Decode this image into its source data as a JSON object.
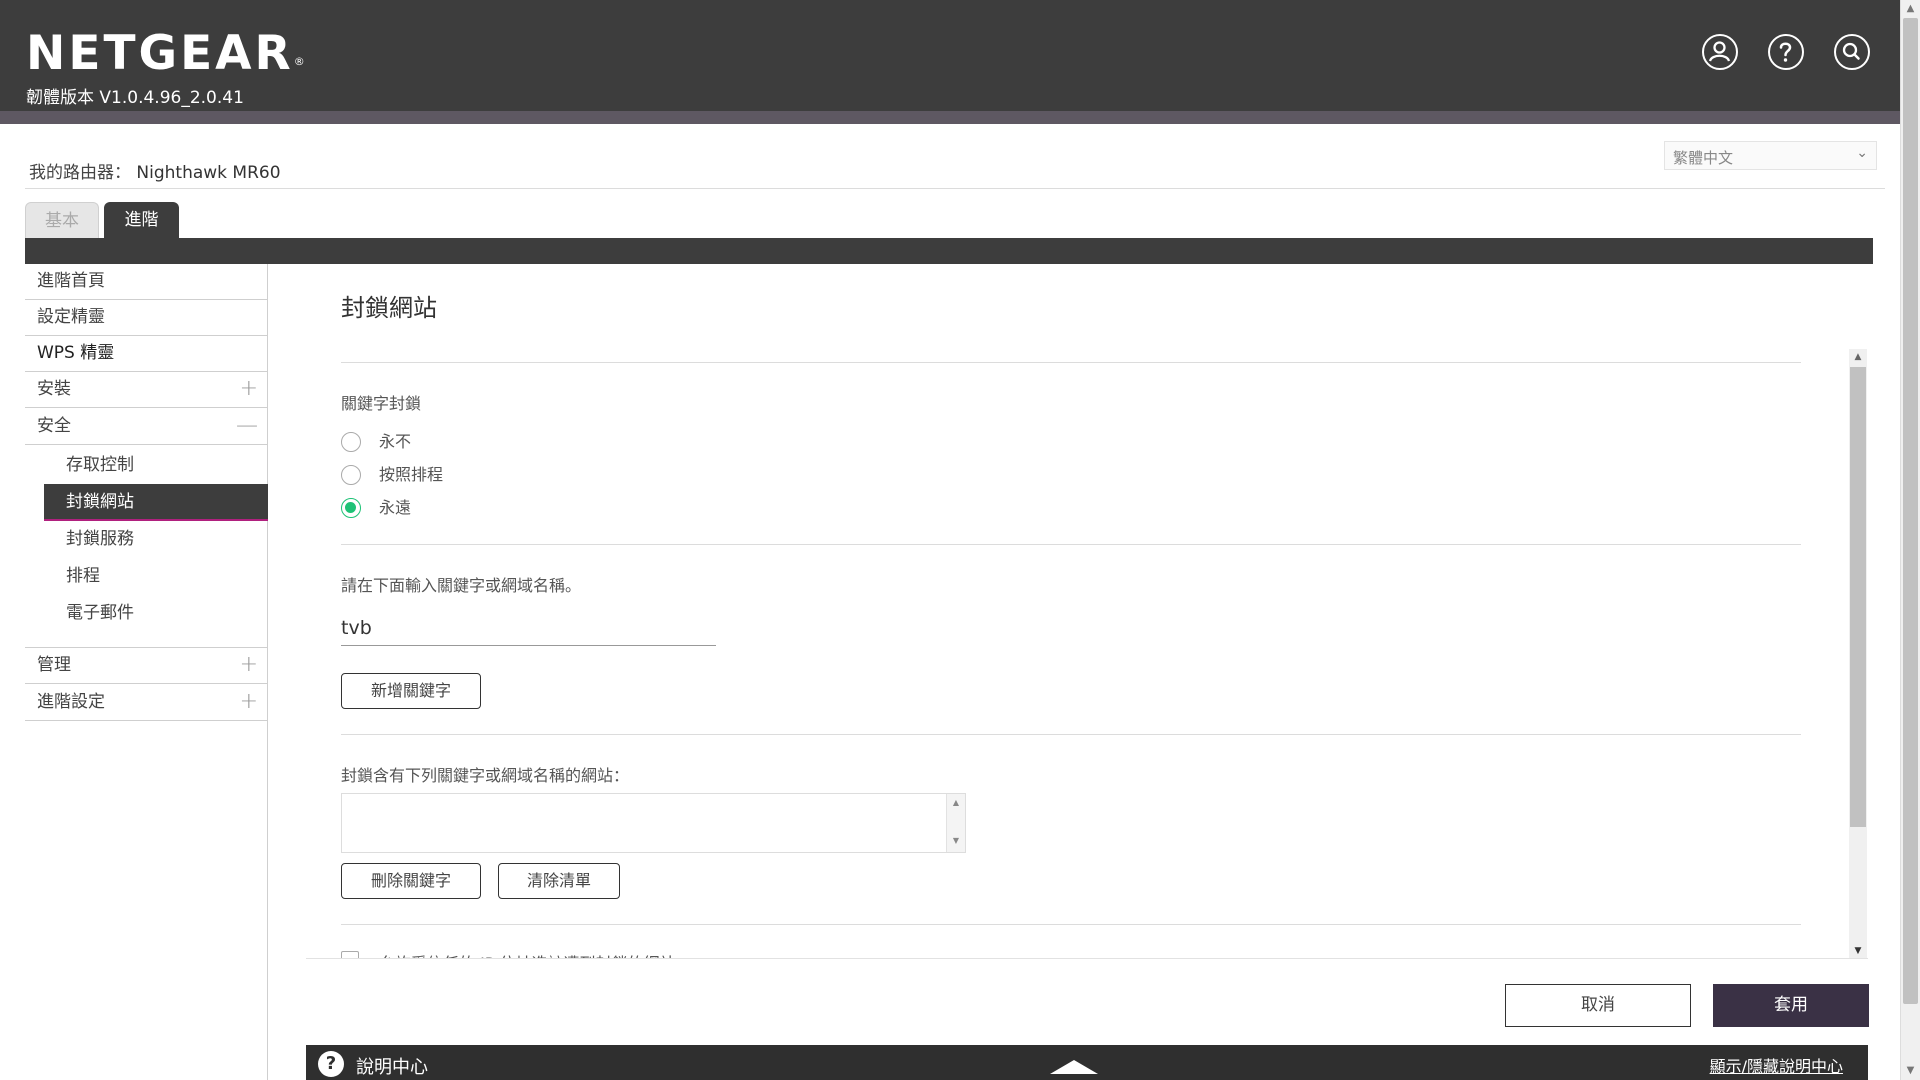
{
  "header": {
    "logo": "NETGEAR",
    "logo_mark": "®",
    "firmware": "韌體版本 V1.0.4.96_2.0.41",
    "icons": [
      "user-icon",
      "help-icon",
      "search-icon"
    ]
  },
  "router": {
    "label": "我的路由器：",
    "name": "Nighthawk MR60"
  },
  "language": {
    "selected": "繁體中文"
  },
  "tabs": [
    {
      "label": "基本",
      "active": false
    },
    {
      "label": "進階",
      "active": true
    }
  ],
  "sidebar": {
    "items": [
      {
        "label": "進階首頁"
      },
      {
        "label": "設定精靈"
      },
      {
        "label": "WPS 精靈"
      },
      {
        "label": "安裝",
        "toggle": "+"
      },
      {
        "label": "安全",
        "toggle": "—"
      }
    ],
    "sub_items": [
      {
        "label": "存取控制"
      },
      {
        "label": "封鎖網站",
        "active": true
      },
      {
        "label": "封鎖服務"
      },
      {
        "label": "排程"
      },
      {
        "label": "電子郵件"
      }
    ],
    "bottom_items": [
      {
        "label": "管理",
        "toggle": "+"
      },
      {
        "label": "進階設定",
        "toggle": "+"
      }
    ]
  },
  "main": {
    "title": "封鎖網站",
    "keyword_blocking_label": "關鍵字封鎖",
    "radio_options": [
      {
        "label": "永不",
        "checked": false
      },
      {
        "label": "按照排程",
        "checked": false
      },
      {
        "label": "永遠",
        "checked": true
      }
    ],
    "input_prompt": "請在下面輸入關鍵字或網域名稱。",
    "input_value": "tvb",
    "add_button": "新增關鍵字",
    "list_label": "封鎖含有下列關鍵字或網域名稱的網站：",
    "delete_button": "刪除關鍵字",
    "clear_button": "清除清單",
    "trusted_ip_label": "允許受信任的 IP 位址造訪遭到封鎖的網站"
  },
  "actions": {
    "cancel": "取消",
    "apply": "套用"
  },
  "help": {
    "label": "說明中心",
    "toggle": "顯示/隱藏說明中心"
  },
  "colors": {
    "header_bg": "#3d3d3d",
    "accent_green": "#1ec276",
    "apply_bg": "#3a3145",
    "active_underline": "#b0207e"
  }
}
